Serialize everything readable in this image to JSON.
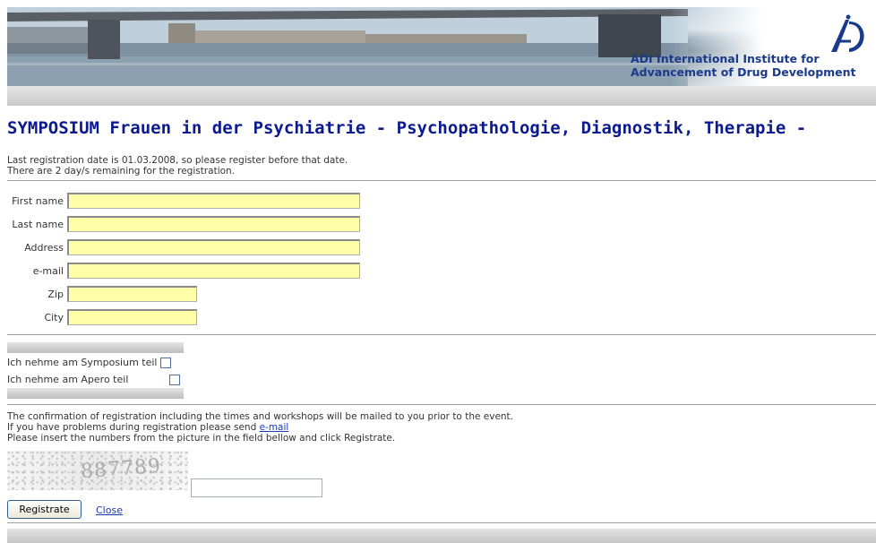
{
  "header": {
    "org_line1": "ADI International Institute for",
    "org_line2": "Advancement of Drug Development"
  },
  "page_title": "SYMPOSIUM Frauen in der Psychiatrie - Psychopathologie, Diagnostik, Therapie -",
  "info": {
    "line1": "Last registration date is 01.03.2008, so please register before that date.",
    "line2": "There are 2 day/s remaining for the registration."
  },
  "form": {
    "first_name_label": "First name",
    "last_name_label": "Last name",
    "address_label": "Address",
    "email_label": "e-mail",
    "zip_label": "Zip",
    "city_label": "City",
    "first_name_value": "",
    "last_name_value": "",
    "address_value": "",
    "email_value": "",
    "zip_value": "",
    "city_value": ""
  },
  "options": {
    "symposium_label": "Ich nehme am Symposium teil",
    "apero_label": "Ich nehme am Apero teil"
  },
  "notes": {
    "line1": "The confirmation of registration including the times and workshops will be mailed to you prior to the event.",
    "line2_prefix": "If you have problems during registration please send ",
    "email_link": "e-mail",
    "line3": "Please insert the numbers from the picture in the field bellow and click Registrate."
  },
  "captcha": {
    "image_text": "887789",
    "input_value": ""
  },
  "actions": {
    "register_label": "Registrate",
    "close_label": "Close"
  },
  "colors": {
    "title": "#0c1a8f",
    "org_name": "#1a3a8c",
    "field_background": "#ffffa8",
    "link": "#1a3ab8"
  }
}
